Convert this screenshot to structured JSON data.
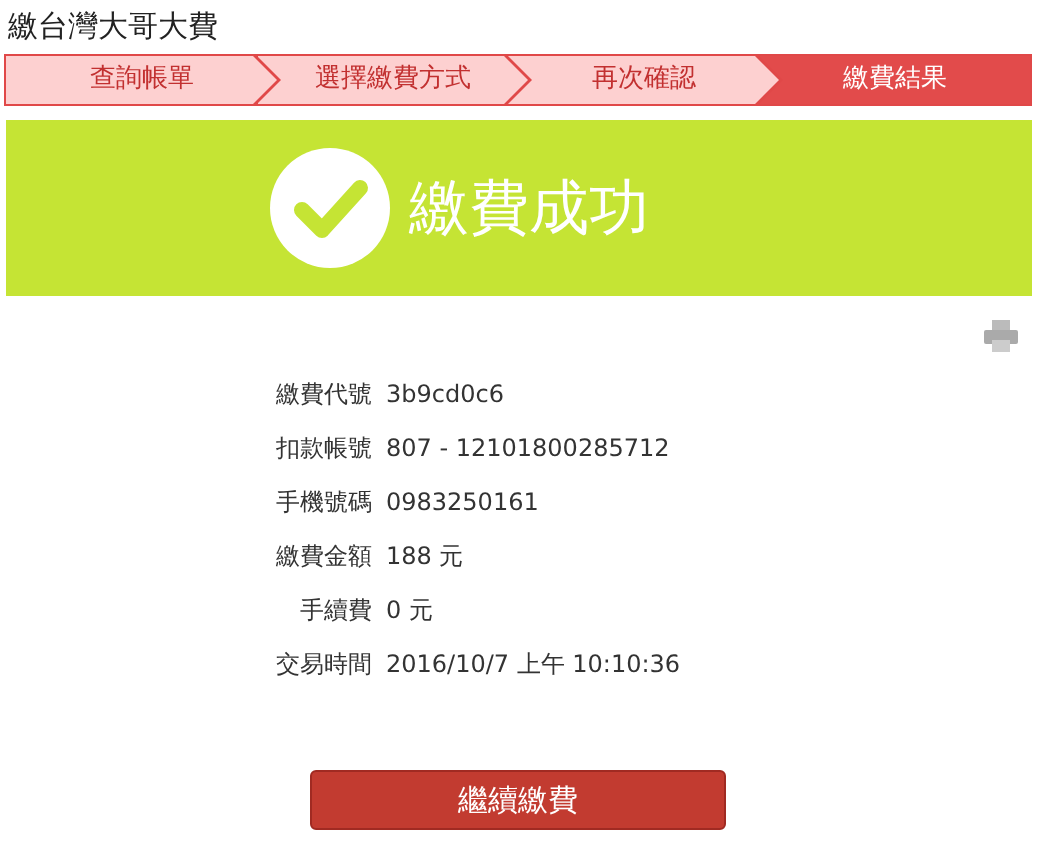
{
  "page_title": "繳台灣大哥大費",
  "steps": [
    {
      "label": "查詢帳單",
      "selected": false
    },
    {
      "label": "選擇繳費方式",
      "selected": false
    },
    {
      "label": "再次確認",
      "selected": false
    },
    {
      "label": "繳費結果",
      "selected": true
    }
  ],
  "banner": {
    "text": "繳費成功"
  },
  "details": [
    {
      "label": "繳費代號",
      "value": "3b9cd0c6"
    },
    {
      "label": "扣款帳號",
      "value": "807 - 12101800285712"
    },
    {
      "label": "手機號碼",
      "value": "0983250161"
    },
    {
      "label": "繳費金額",
      "value": "188 元"
    },
    {
      "label": "手續費",
      "value": "0 元"
    },
    {
      "label": "交易時間",
      "value": "2016/10/7 上午 10:10:36"
    }
  ],
  "button": "繼續繳費"
}
